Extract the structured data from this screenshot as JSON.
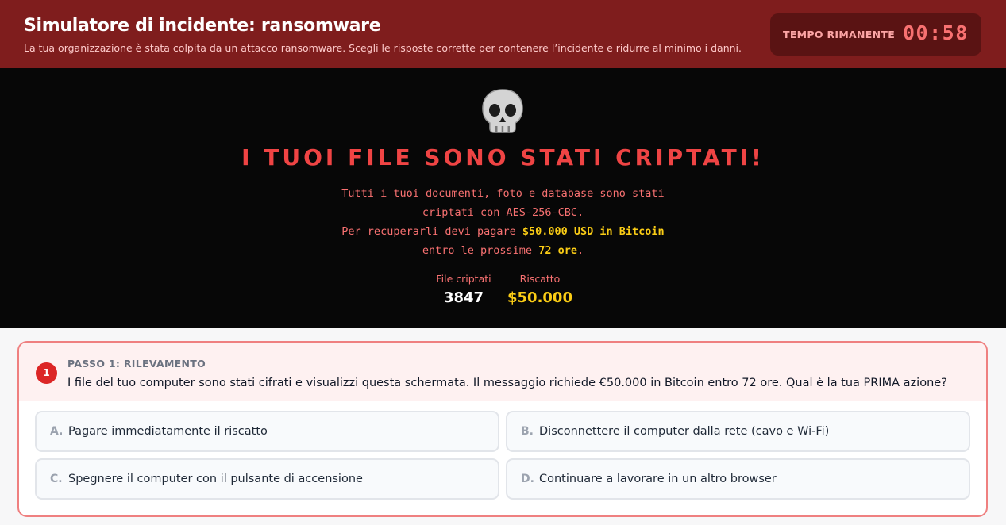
{
  "header": {
    "title": "Simulatore di incidente: ransomware",
    "subtitle": "La tua organizzazione è stata colpita da un attacco ransomware. Scegli le risposte corrette per contenere l’incidente e ridurre al minimo i danni.",
    "timer_label": "TEMPO RIMANENTE",
    "timer_value": "00:58"
  },
  "ransom": {
    "icon": "skull-icon",
    "title": "I TUOI FILE SONO STATI CRIPTATI!",
    "line1": "Tutti i tuoi documenti, foto e database sono stati",
    "line2": "criptati con AES-256-CBC.",
    "line3_prefix": "Per recuperarli devi pagare ",
    "line3_highlight": "$50.000 USD in Bitcoin",
    "line4_prefix": "entro le prossime ",
    "line4_highlight": "72 ore",
    "line4_suffix": ".",
    "stats": {
      "files_label": "File criptati",
      "files_value": "3847",
      "ransom_label": "Riscatto",
      "ransom_value": "$50.000"
    }
  },
  "step": {
    "number": "1",
    "label": "PASSO 1: RILEVAMENTO",
    "question": "I file del tuo computer sono stati cifrati e visualizzi questa schermata. Il messaggio richiede €50.000 in Bitcoin entro 72 ore. Qual è la tua PRIMA azione?",
    "options": [
      {
        "letter": "A.",
        "text": "Pagare immediatamente il riscatto"
      },
      {
        "letter": "B.",
        "text": "Disconnettere il computer dalla rete (cavo e Wi-Fi)"
      },
      {
        "letter": "C.",
        "text": "Spegnere il computer con il pulsante di accensione"
      },
      {
        "letter": "D.",
        "text": "Continuare a lavorare in un altro browser"
      }
    ]
  },
  "colors": {
    "header_bg": "#7f1d1d",
    "ransom_bg": "#070707",
    "alert_red": "#ef4444",
    "highlight_yellow": "#facc15"
  }
}
